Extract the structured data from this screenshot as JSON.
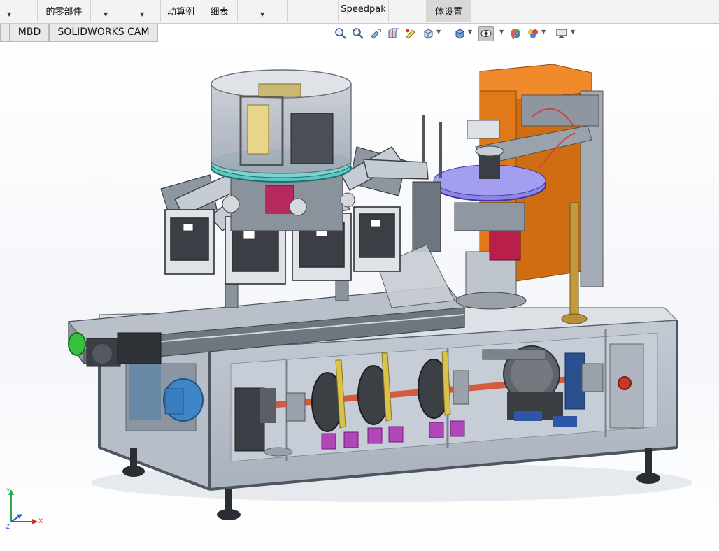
{
  "ribbon": {
    "buttons": [
      {
        "label": "",
        "top_text": "",
        "arrow": true
      },
      {
        "label": "的零部件",
        "top_text": "",
        "arrow": false
      },
      {
        "label": "",
        "top_text": "",
        "arrow": true
      },
      {
        "label": "",
        "top_text": "",
        "arrow": true
      },
      {
        "label": "动算例",
        "top_text": "",
        "arrow": false
      },
      {
        "label": "细表",
        "top_text": "",
        "arrow": false
      },
      {
        "label": "",
        "top_text": "",
        "arrow": true
      },
      {
        "label": "",
        "top_text": "",
        "arrow": false
      },
      {
        "label": "Speedpak",
        "top_text": "",
        "arrow": false
      },
      {
        "label": "",
        "top_text": "",
        "arrow": false
      },
      {
        "label": "体设置",
        "top_text": "",
        "arrow": false
      }
    ]
  },
  "tabs": [
    {
      "label": ""
    },
    {
      "label": "MBD"
    },
    {
      "label": "SOLIDWORKS CAM"
    }
  ],
  "view_toolbar": {
    "icons": [
      "zoom-to-fit-icon",
      "zoom-to-area-icon",
      "previous-view-icon",
      "section-view-icon",
      "dynamic-annotation-view-icon",
      "view-orientation-icon",
      "display-style-icon",
      "hide-show-items-icon",
      "edit-appearance-icon",
      "apply-scene-icon",
      "view-settings-icon"
    ]
  },
  "triad": {
    "x_label": "X",
    "y_label": "Y",
    "z_label": "Z"
  },
  "colors": {
    "accent_orange": "#e07a18",
    "purple_disk": "#8c86e6",
    "cyan_disk": "#5fc6c4",
    "magenta_bracket": "#b046b8",
    "green_roller": "#38c13a",
    "red_shaft": "#d65a3c"
  }
}
